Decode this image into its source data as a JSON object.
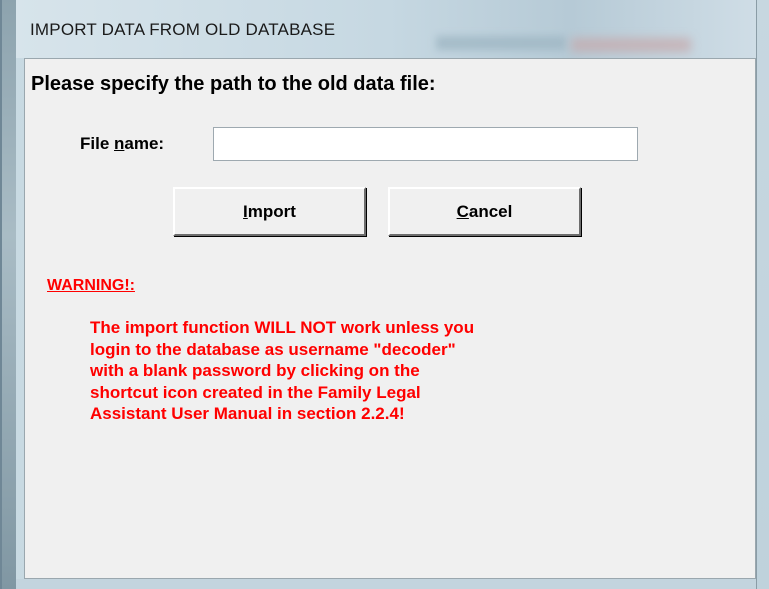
{
  "window": {
    "title": "IMPORT DATA FROM OLD DATABASE"
  },
  "dialog": {
    "heading": "Please specify the path to the old data file:",
    "file_label": "File name:",
    "file_value": "",
    "file_placeholder": "",
    "import_label": "Import",
    "cancel_label": "Cancel"
  },
  "warning": {
    "title": "WARNING!:",
    "lines": [
      "The import function WILL NOT work unless you",
      "login to the database as username \"decoder\"",
      "with a blank password by clicking on the",
      "shortcut icon created in the Family Legal",
      "Assistant User Manual in section 2.2.4!"
    ],
    "color": "#ff0000"
  }
}
